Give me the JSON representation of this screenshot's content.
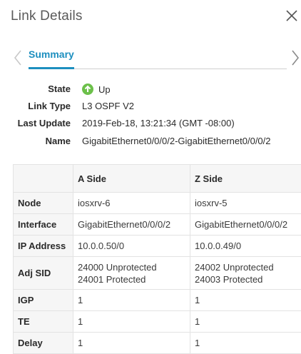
{
  "header": {
    "title": "Link Details"
  },
  "tabs": [
    {
      "label": "Summary",
      "active": true
    }
  ],
  "details": {
    "state": {
      "label": "State",
      "value": "Up",
      "status_color": "#6cc04a"
    },
    "link_type": {
      "label": "Link Type",
      "value": "L3 OSPF V2"
    },
    "last_update": {
      "label": "Last Update",
      "value": "2019-Feb-18, 13:21:34 (GMT -08:00)"
    },
    "name": {
      "label": "Name",
      "value": "GigabitEthernet0/0/0/2-GigabitEthernet0/0/0/2"
    }
  },
  "table": {
    "headers": [
      "",
      "A Side",
      "Z Side"
    ],
    "rows": [
      {
        "label": "Node",
        "a": "iosxrv-6",
        "z": "iosxrv-5"
      },
      {
        "label": "Interface",
        "a": "GigabitEthernet0/0/0/2",
        "z": "GigabitEthernet0/0/0/2"
      },
      {
        "label": "IP Address",
        "a": "10.0.0.50/0",
        "z": "10.0.0.49/0"
      },
      {
        "label": "Adj SID",
        "a": "24000 Unprotected",
        "a2": "24001 Protected",
        "z": "24002 Unprotected",
        "z2": "24003 Protected"
      },
      {
        "label": "IGP",
        "a": "1",
        "z": "1"
      },
      {
        "label": "TE",
        "a": "1",
        "z": "1"
      },
      {
        "label": "Delay",
        "a": "1",
        "z": "1"
      }
    ]
  },
  "icons": {
    "close": "close-icon",
    "prev": "chevron-left-icon",
    "next": "chevron-right-icon",
    "status": "arrow-up-circle-icon"
  },
  "colors": {
    "accent": "#1d8fbf",
    "status_up": "#6cc04a"
  }
}
